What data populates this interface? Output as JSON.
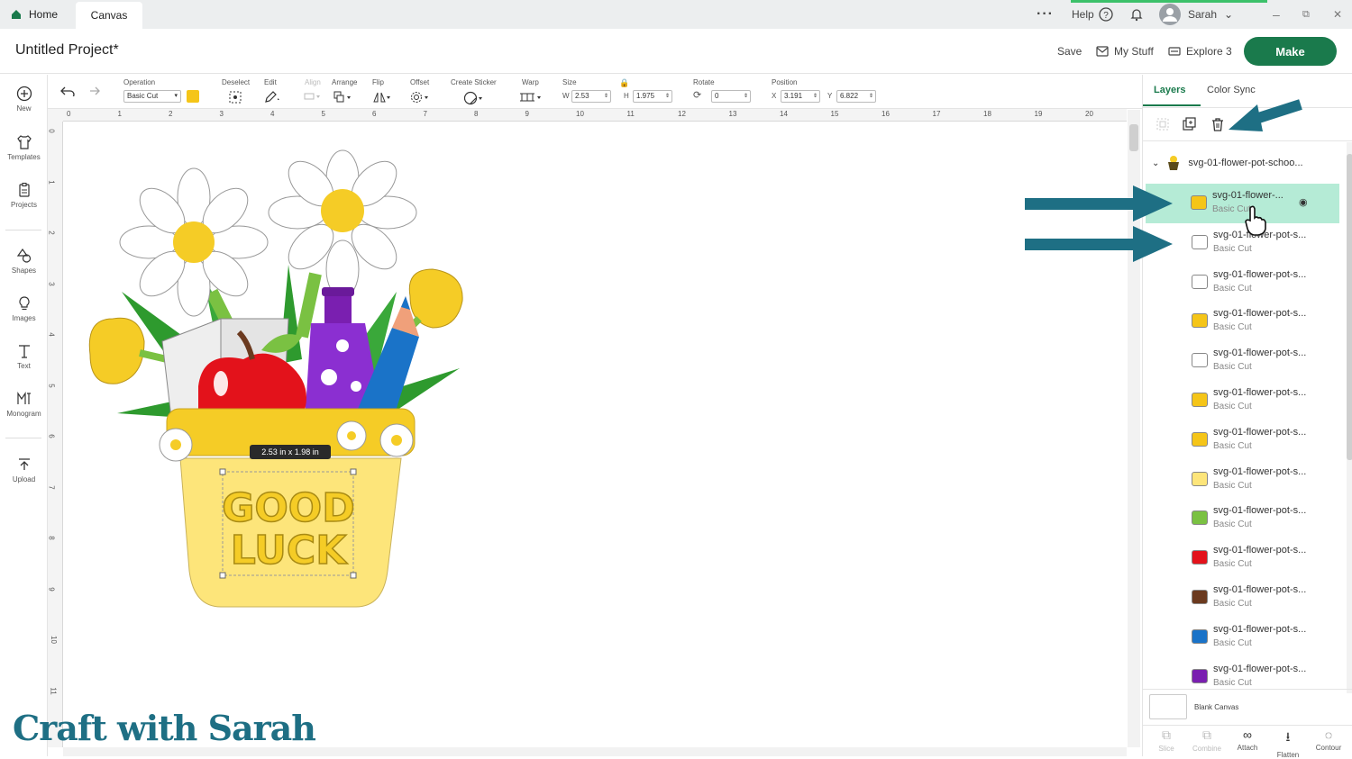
{
  "tabs": {
    "home": "Home",
    "canvas": "Canvas"
  },
  "topbar": {
    "help": "Help",
    "user": "Sarah"
  },
  "header": {
    "project_title": "Untitled Project*",
    "save": "Save",
    "my_stuff": "My Stuff",
    "machine": "Explore 3",
    "make": "Make"
  },
  "toolbar": {
    "operation_label": "Operation",
    "operation_value": "Basic Cut",
    "deselect": "Deselect",
    "edit": "Edit",
    "align": "Align",
    "arrange": "Arrange",
    "flip": "Flip",
    "offset": "Offset",
    "create_sticker": "Create Sticker",
    "warp": "Warp",
    "size": "Size",
    "rotate": "Rotate",
    "position": "Position",
    "w_label": "W",
    "w_value": "2.53",
    "h_label": "H",
    "h_value": "1.975",
    "rotate_value": "0",
    "x_label": "X",
    "x_value": "3.191",
    "y_label": "Y",
    "y_value": "6.822",
    "accent_color": "#f5c518"
  },
  "sidebar": [
    {
      "label": "New",
      "icon": "plus-circle-icon"
    },
    {
      "label": "Templates",
      "icon": "shirt-icon"
    },
    {
      "label": "Projects",
      "icon": "clipboard-icon"
    },
    {
      "label": "Shapes",
      "icon": "shapes-icon"
    },
    {
      "label": "Images",
      "icon": "lightbulb-icon"
    },
    {
      "label": "Text",
      "icon": "text-icon"
    },
    {
      "label": "Monogram",
      "icon": "monogram-icon"
    },
    {
      "label": "Upload",
      "icon": "upload-icon"
    }
  ],
  "ruler": {
    "h": [
      "0",
      "1",
      "2",
      "3",
      "4",
      "5",
      "6",
      "7",
      "8",
      "9",
      "10",
      "11",
      "12",
      "13",
      "14",
      "15",
      "16",
      "17",
      "18",
      "19",
      "20"
    ],
    "v": [
      "0",
      "1",
      "2",
      "3",
      "4",
      "5",
      "6",
      "7",
      "8",
      "9",
      "10",
      "11"
    ]
  },
  "canvas": {
    "size_tooltip": "2.53  in x 1.98  in"
  },
  "panel": {
    "tab_layers": "Layers",
    "tab_color_sync": "Color Sync",
    "group_name": "svg-01-flower-pot-schoo...",
    "layers": [
      {
        "name": "svg-01-flower-...",
        "op": "Basic Cut",
        "color": "#f5c518",
        "selected": true
      },
      {
        "name": "svg-01-flower-pot-s...",
        "op": "Basic Cut",
        "color": "#ffffff"
      },
      {
        "name": "svg-01-flower-pot-s...",
        "op": "Basic Cut",
        "color": "#ffffff"
      },
      {
        "name": "svg-01-flower-pot-s...",
        "op": "Basic Cut",
        "color": "#f5c518"
      },
      {
        "name": "svg-01-flower-pot-s...",
        "op": "Basic Cut",
        "color": "#ffffff"
      },
      {
        "name": "svg-01-flower-pot-s...",
        "op": "Basic Cut",
        "color": "#f5c518"
      },
      {
        "name": "svg-01-flower-pot-s...",
        "op": "Basic Cut",
        "color": "#f5c518"
      },
      {
        "name": "svg-01-flower-pot-s...",
        "op": "Basic Cut",
        "color": "#fde57a"
      },
      {
        "name": "svg-01-flower-pot-s...",
        "op": "Basic Cut",
        "color": "#7ac142"
      },
      {
        "name": "svg-01-flower-pot-s...",
        "op": "Basic Cut",
        "color": "#e3121b"
      },
      {
        "name": "svg-01-flower-pot-s...",
        "op": "Basic Cut",
        "color": "#6b3a1f"
      },
      {
        "name": "svg-01-flower-pot-s...",
        "op": "Basic Cut",
        "color": "#1a73c8"
      },
      {
        "name": "svg-01-flower-pot-s...",
        "op": "Basic Cut",
        "color": "#7a1fb0"
      }
    ],
    "blank_canvas": "Blank Canvas",
    "bottom_tools": [
      "Slice",
      "Combine",
      "Attach",
      "Flatten",
      "Contour"
    ]
  },
  "watermark": "Craft with Sarah"
}
